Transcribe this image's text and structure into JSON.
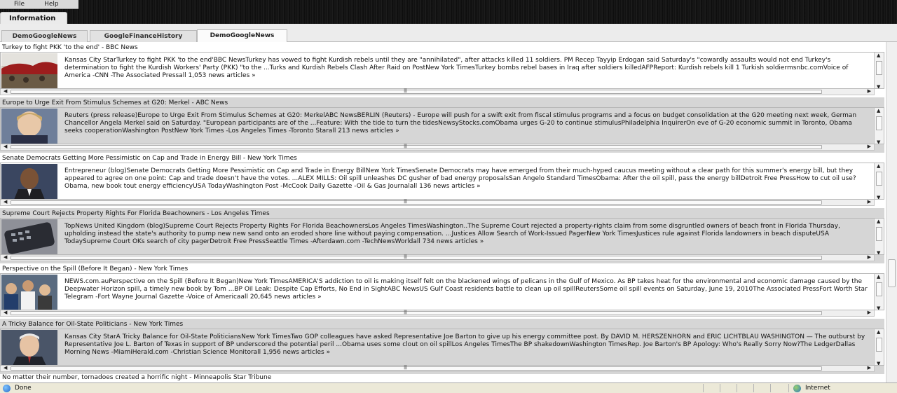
{
  "menu": {
    "file": "File",
    "help": "Help"
  },
  "window_tab": "Information",
  "tabs": [
    {
      "label": "DemoGoogleNews"
    },
    {
      "label": "GoogleFinanceHistory"
    },
    {
      "label": "DemoGoogleNews"
    }
  ],
  "news": [
    {
      "title": "Turkey to fight PKK 'to the end' - BBC News",
      "body": "Kansas City StarTurkey to fight PKK 'to the end'BBC NewsTurkey has vowed to fight Kurdish rebels until they are \"annihilated\", after attacks killed 11 soldiers. PM Recep Tayyip Erdogan said Saturday's \"cowardly assaults would not end Turkey's determination to fight the Kurdish Workers' Party (PKK) \"to the ...Turks and Kurdish Rebels Clash After Raid on PostNew York TimesTurkey bombs rebel bases in Iraq after soldiers killedAFPReport: Kurdish rebels kill 1 Turkish soldiermsnbc.comVoice of America -CNN -The Associated Pressall 1,053 news articles »"
    },
    {
      "title": "Europe to Urge Exit From Stimulus Schemes at G20: Merkel - ABC News",
      "body": "Reuters (press release)Europe to Urge Exit From Stimulus Schemes at G20: MerkelABC NewsBERLIN (Reuters) - Europe will push for a swift exit from fiscal stimulus programs and a focus on budget consolidation at the G20 meeting next week, German Chancellor Angela Merkel said on Saturday. \"European participants are of the ...Feature: With the tide to turn the tidesNewsyStocks.comObama urges G-20 to continue stimulusPhiladelphia InquirerOn eve of G-20 economic summit in Toronto, Obama seeks cooperationWashington PostNew York Times -Los Angeles Times -Toronto Starall 213 news articles »"
    },
    {
      "title": "Senate Democrats Getting More Pessimistic on Cap and Trade in Energy Bill - New York Times",
      "body": "Entrepreneur (blog)Senate Democrats Getting More Pessimistic on Cap and Trade in Energy BillNew York TimesSenate Democrats may have emerged from their much-hyped caucus meeting without a clear path for this summer's energy bill, but they appeared to agree on one point: Cap and trade doesn't have the votes. ...ALEX MILLS: Oil spill unleashes DC gusher of bad energy proposalsSan Angelo Standard TimesObama: After the oil spill, pass the energy billDetroit Free PressHow to cut oil use? Obama, new book tout energy efficiencyUSA TodayWashington Post -McCook Daily Gazette -Oil & Gas Journalall 136 news articles »"
    },
    {
      "title": "Supreme Court Rejects Property Rights For Florida Beachowners - Los Angeles Times",
      "body": "TopNews United Kingdom (blog)Supreme Court Rejects Property Rights For Florida BeachownersLos Angeles TimesWashington..The Supreme Court rejected a property-rights claim from some disgruntled owners of beach front in Florida Thursday, upholding instead the state's authority to pump new new sand onto an eroded shore line without paying compensation. ...Justices Allow Search of Work-Issued PagerNew York TimesJustices rule against Florida landowners in beach disputeUSA TodaySupreme Court OKs search of city pagerDetroit Free PressSeattle Times -Afterdawn.com -TechNewsWorldall 734 news articles »"
    },
    {
      "title": "Perspective on the Spill (Before It Began) - New York Times",
      "body": "NEWS.com.auPerspective on the Spill (Before It Began)New York TimesAMERICA'S addiction to oil is making itself felt on the blackened wings of pelicans in the Gulf of Mexico. As BP takes heat for the environmental and economic damage caused by the Deepwater Horizon spill, a timely new book by Tom ...BP Oil Leak: Despite Cap Efforts, No End in SightABC NewsUS Gulf Coast residents battle to clean up oil spillReutersSome oil spill events on Saturday, June 19, 2010The Associated PressFort Worth Star Telegram -Fort Wayne Journal Gazette -Voice of Americaall 20,645 news articles »"
    },
    {
      "title": "A Tricky Balance for Oil-State Politicians - New York Times",
      "body": "Kansas City StarA Tricky Balance for Oil-State PoliticiansNew York TimesTwo GOP colleagues have asked Representative Joe Barton to give up his energy committee post. By DAVID M. HERSZENHORN and ERIC LICHTBLAU WASHINGTON — The outburst by Representative Joe L. Barton of Texas in support of BP underscored the potential peril ...Obama uses some clout on oil spillLos Angeles TimesThe BP shakedownWashington TimesRep. Joe Barton's BP Apology: Who's Really Sorry Now?The LedgerDallas Morning News -MiamiHerald.com -Christian Science Monitorall 1,956 news articles »"
    }
  ],
  "last_title": "No matter their number, tornadoes created a horrific night - Minneapolis Star Tribune",
  "status": {
    "text": "Done",
    "zone": "Internet"
  },
  "icons": {
    "status": "page-done-icon",
    "zone": "internet-globe-icon"
  }
}
